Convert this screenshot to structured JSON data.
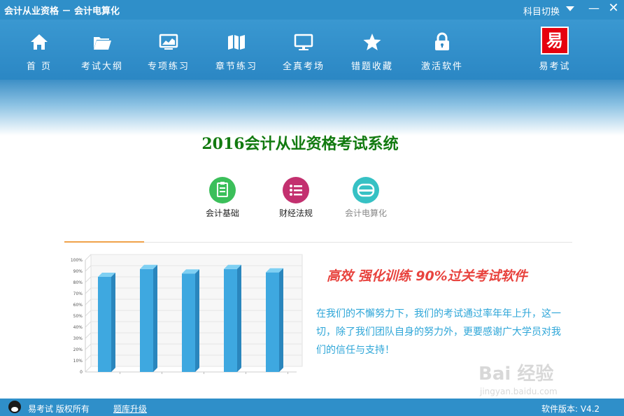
{
  "titlebar": {
    "app_title": "会计从业资格 － 会计电算化",
    "subject_switch": "科目切换",
    "minimize": "—",
    "close": "✕"
  },
  "toolbar": {
    "items": [
      {
        "label": "首 页",
        "icon": "home-icon"
      },
      {
        "label": "考试大纲",
        "icon": "folder-icon"
      },
      {
        "label": "专项练习",
        "icon": "monitor-chart-icon"
      },
      {
        "label": "章节练习",
        "icon": "map-icon"
      },
      {
        "label": "全真考场",
        "icon": "screen-icon"
      },
      {
        "label": "错题收藏",
        "icon": "star-icon"
      },
      {
        "label": "激活软件",
        "icon": "lock-icon"
      }
    ],
    "brand": {
      "logo_text": "易",
      "label": "易考试"
    }
  },
  "main": {
    "title": "2016会计从业资格考试系统",
    "subjects": [
      {
        "name": "会计基础",
        "color": "#3bbf5a"
      },
      {
        "name": "财经法规",
        "color": "#c3306f"
      },
      {
        "name": "会计电算化",
        "color": "#36c1c4"
      }
    ],
    "slogan": "高效 强化训练 90%过关考试软件",
    "description": "在我们的不懈努力下，我们的考试通过率年年上升，这一切，除了我们团队自身的努力外，更要感谢广大学员对我们的信任与支持！",
    "watermark": "Bai 经验",
    "watermark_url": "jingyan.baidu.com"
  },
  "chart_data": {
    "type": "bar",
    "categories": [
      "",
      "",
      "",
      "",
      ""
    ],
    "values": [
      85,
      92,
      88,
      92,
      89
    ],
    "ylim": [
      0,
      100
    ],
    "yticks": [
      "0",
      "10%",
      "20%",
      "30%",
      "40%",
      "50%",
      "60%",
      "70%",
      "80%",
      "90%",
      "100%"
    ],
    "grid": true,
    "bar_color": "#3ea8e0"
  },
  "statusbar": {
    "copyright": "易考试  版权所有",
    "upgrade": "题库升级",
    "version": "软件版本: V4.2"
  }
}
